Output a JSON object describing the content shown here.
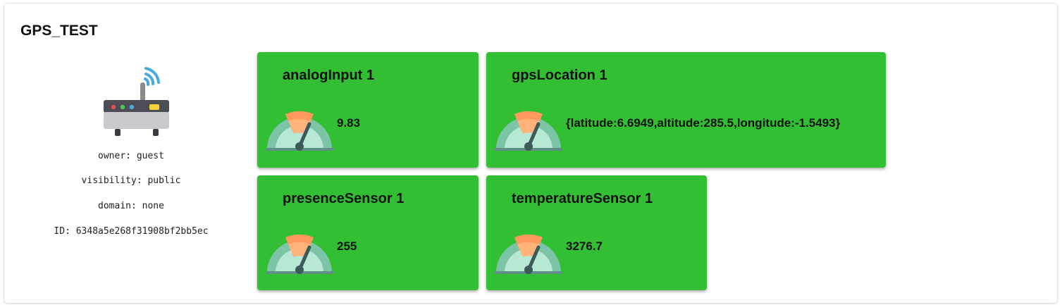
{
  "device": {
    "title": "GPS_TEST",
    "icon": "router-icon",
    "owner_line": "owner: guest",
    "visibility_line": "visibility: public",
    "domain_line": "domain: none",
    "id_line": "ID: 6348a5e268f31908bf2bb5ec"
  },
  "sensors": [
    {
      "name": "analogInput 1",
      "value": "9.83",
      "icon": "gauge-icon"
    },
    {
      "name": "gpsLocation 1",
      "value": "{latitude:6.6949,altitude:285.5,longitude:-1.5493}",
      "icon": "gauge-icon"
    },
    {
      "name": "presenceSensor 1",
      "value": "255",
      "icon": "gauge-icon"
    },
    {
      "name": "temperatureSensor 1",
      "value": "3276.7",
      "icon": "gauge-icon"
    }
  ],
  "colors": {
    "sensor_card": "#33bf33",
    "gauge_orange": "#ff8c42",
    "gauge_mint": "#8fd3b6",
    "gauge_needle": "#3d5a5a"
  }
}
